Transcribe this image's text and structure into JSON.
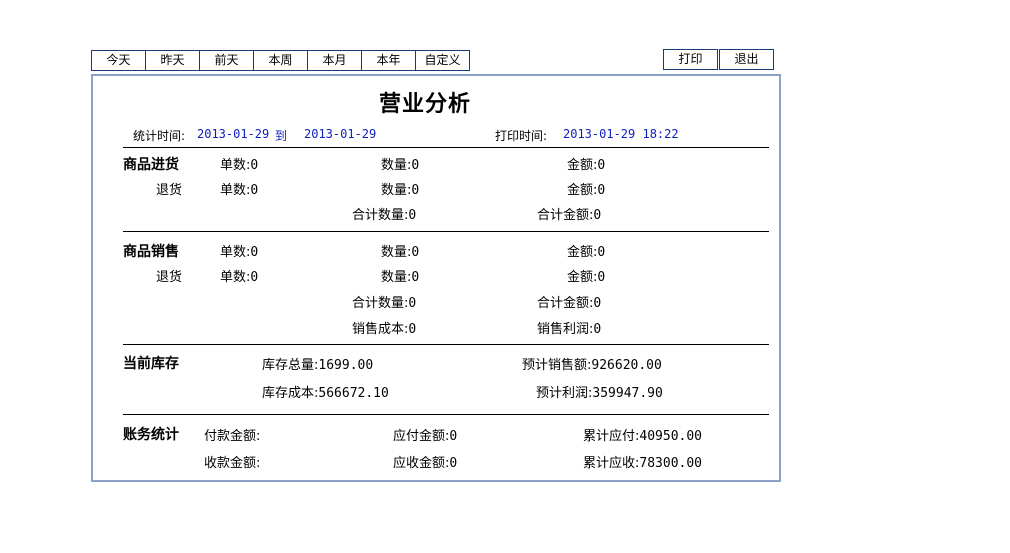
{
  "toolbar": {
    "today": "今天",
    "yesterday": "昨天",
    "day_before": "前天",
    "this_week": "本周",
    "this_month": "本月",
    "this_year": "本年",
    "custom": "自定义",
    "print": "打印",
    "exit": "退出"
  },
  "report": {
    "title": "营业分析",
    "stat_time_label": "统计时间:",
    "stat_start": "2013-01-29",
    "to": "到",
    "stat_end": "2013-01-29",
    "print_time_label": "打印时间:",
    "print_time": "2013-01-29 18:22"
  },
  "purchase": {
    "section": "商品进货",
    "return_label": "退货",
    "orders_label": "单数:",
    "orders": "0",
    "qty_label": "数量:",
    "qty": "0",
    "amount_label": "金额:",
    "amount": "0",
    "ret_orders": "0",
    "ret_qty": "0",
    "ret_amount": "0",
    "total_qty_label": "合计数量:",
    "total_qty": "0",
    "total_amount_label": "合计金额:",
    "total_amount": "0"
  },
  "sales": {
    "section": "商品销售",
    "return_label": "退货",
    "orders_label": "单数:",
    "orders": "0",
    "qty_label": "数量:",
    "qty": "0",
    "amount_label": "金额:",
    "amount": "0",
    "ret_orders": "0",
    "ret_qty": "0",
    "ret_amount": "0",
    "total_qty_label": "合计数量:",
    "total_qty": "0",
    "total_amount_label": "合计金额:",
    "total_amount": "0",
    "cost_label": "销售成本:",
    "cost": "0",
    "profit_label": "销售利润:",
    "profit": "0"
  },
  "inventory": {
    "section": "当前库存",
    "total_qty_label": "库存总量:",
    "total_qty": "1699.00",
    "est_sales_label": "预计销售额:",
    "est_sales": "926620.00",
    "cost_label": "库存成本:",
    "cost": "566672.10",
    "est_profit_label": "预计利润:",
    "est_profit": "359947.90"
  },
  "accounts": {
    "section": "账务统计",
    "paid_label": "付款金额:",
    "paid": "",
    "payable_label": "应付金额:",
    "payable": "0",
    "cum_payable_label": "累计应付:",
    "cum_payable": "40950.00",
    "received_label": "收款金额:",
    "received": "",
    "receivable_label": "应收金额:",
    "receivable": "0",
    "cum_receivable_label": "累计应收:",
    "cum_receivable": "78300.00"
  }
}
